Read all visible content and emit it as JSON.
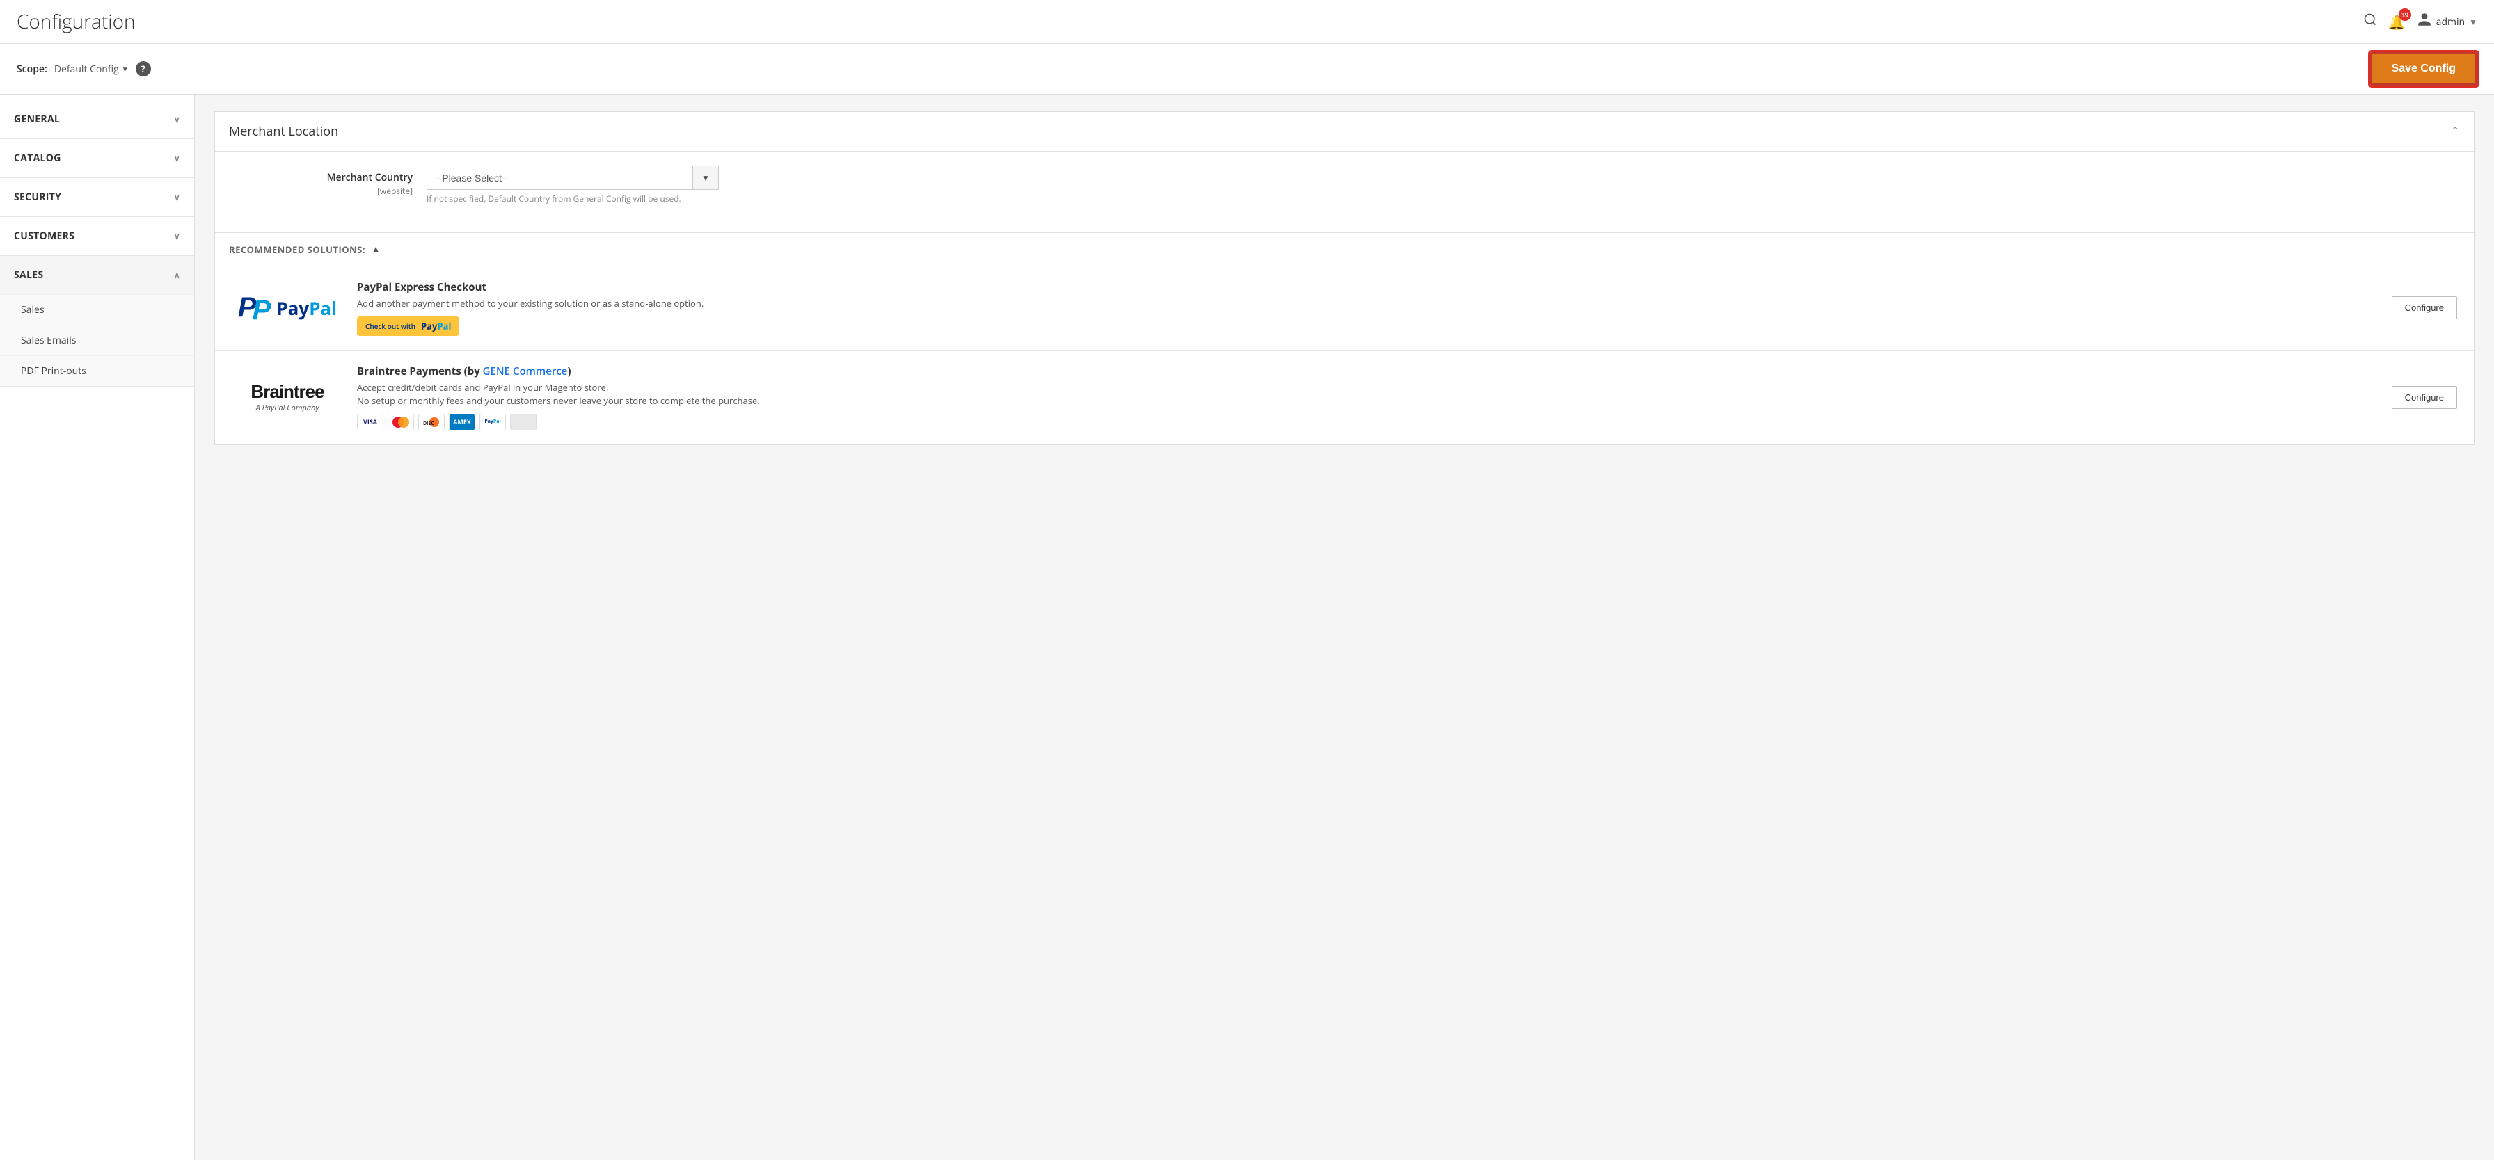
{
  "header": {
    "title": "Configuration",
    "notification_count": "39",
    "user_name": "admin"
  },
  "scope_bar": {
    "scope_label": "Scope:",
    "scope_value": "Default Config",
    "save_button": "Save Config",
    "help_icon": "?"
  },
  "sidebar": {
    "items": [
      {
        "id": "general",
        "label": "GENERAL",
        "expanded": false
      },
      {
        "id": "catalog",
        "label": "CATALOG",
        "expanded": false
      },
      {
        "id": "security",
        "label": "SECURITY",
        "expanded": false
      },
      {
        "id": "customers",
        "label": "CUSTOMERS",
        "expanded": false
      },
      {
        "id": "sales",
        "label": "SALES",
        "expanded": true
      }
    ],
    "sub_items": [
      {
        "label": "Sales"
      },
      {
        "label": "Sales Emails"
      },
      {
        "label": "PDF Print-outs"
      }
    ]
  },
  "content": {
    "section_title": "Merchant Location",
    "collapse_icon": "⌃",
    "merchant_country_label": "Merchant Country",
    "merchant_country_sublabel": "[website]",
    "merchant_country_placeholder": "--Please Select--",
    "merchant_country_hint": "If not specified, Default Country from General Config will be used.",
    "recommended_solutions_label": "RECOMMENDED SOLUTIONS:",
    "recommended_arrow": "▲",
    "payments": [
      {
        "id": "paypal",
        "name": "PayPal Express Checkout",
        "description": "Add another payment method to your existing solution or as a stand-alone option.",
        "checkout_button_text": "Check out with PayPal",
        "configure_label": "Configure"
      },
      {
        "id": "braintree",
        "name": "Braintree Payments (by ",
        "name_link": "GENE Commerce",
        "name_end": ")",
        "description_line1": "Accept credit/debit cards and PayPal in your Magento store.",
        "description_line2": "No setup or monthly fees and your customers never leave your store to complete the purchase.",
        "configure_label": "Configure"
      }
    ]
  }
}
